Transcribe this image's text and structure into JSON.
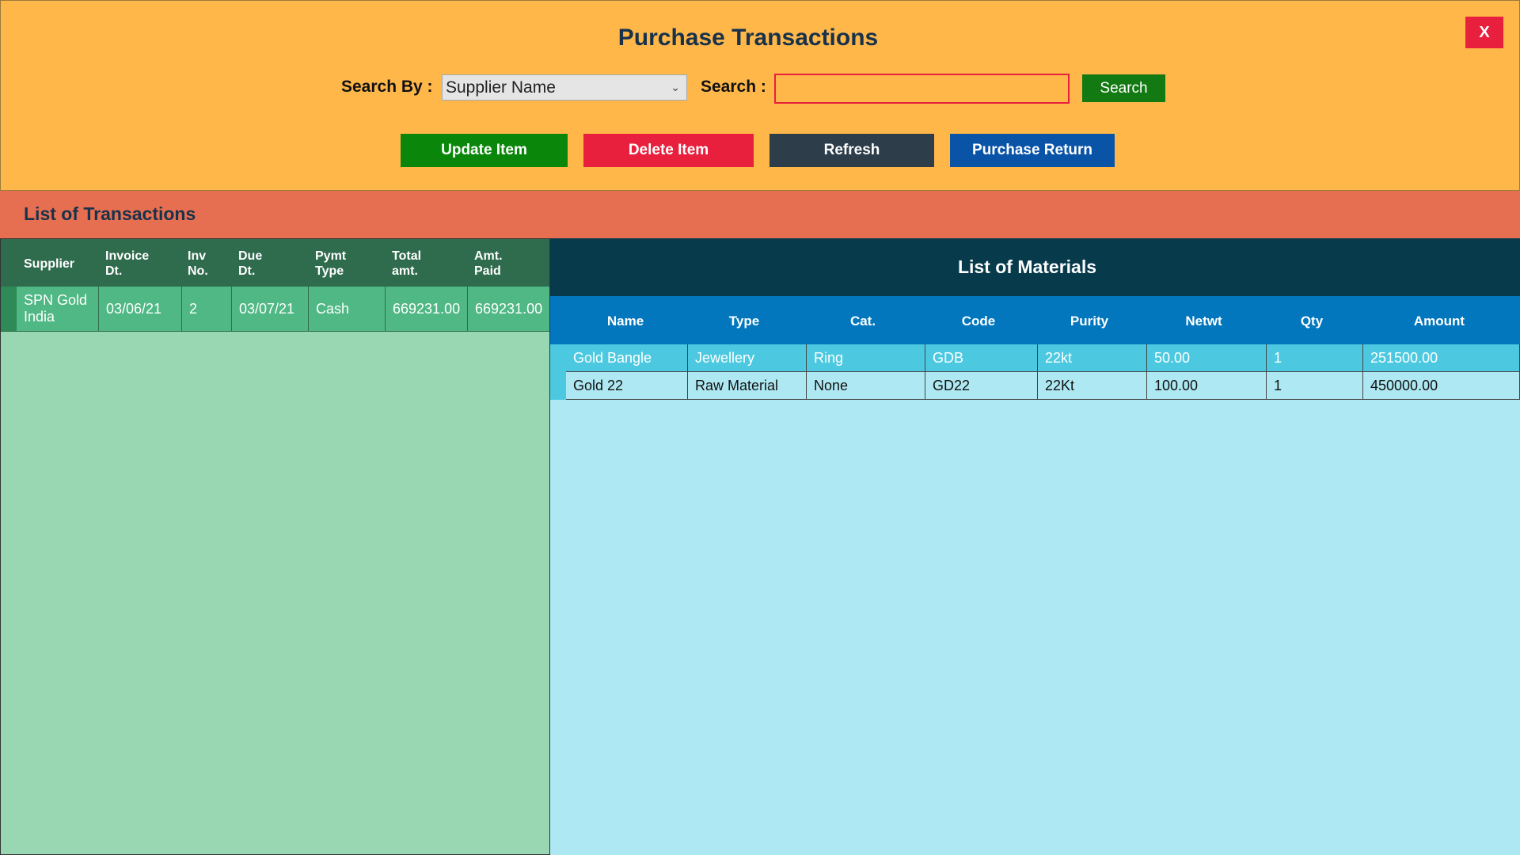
{
  "header": {
    "title": "Purchase Transactions",
    "close_label": "X",
    "search_by_label": "Search By :",
    "search_by_value": "Supplier Name",
    "search_label": "Search :",
    "search_value": "",
    "search_button": "Search",
    "actions": {
      "update": "Update Item",
      "delete": "Delete Item",
      "refresh": "Refresh",
      "purchase_return": "Purchase Return"
    }
  },
  "section_title": "List of Transactions",
  "transactions": {
    "columns": [
      "Supplier",
      "Invoice Dt.",
      "Inv No.",
      "Due Dt.",
      "Pymt Type",
      "Total amt.",
      "Amt. Paid"
    ],
    "rows": [
      {
        "supplier": "SPN Gold India",
        "invoice_dt": "03/06/21",
        "inv_no": "2",
        "due_dt": "03/07/21",
        "pymt_type": "Cash",
        "total_amt": "669231.00",
        "amt_paid": "669231.00"
      }
    ]
  },
  "materials": {
    "title": "List of Materials",
    "columns": [
      "Name",
      "Type",
      "Cat.",
      "Code",
      "Purity",
      "Netwt",
      "Qty",
      "Amount"
    ],
    "rows": [
      {
        "name": "Gold Bangle",
        "type": "Jewellery",
        "cat": "Ring",
        "code": "GDB",
        "purity": "22kt",
        "netwt": "50.00",
        "qty": "1",
        "amount": "251500.00"
      },
      {
        "name": "Gold 22",
        "type": "Raw Material",
        "cat": "None",
        "code": "GD22",
        "purity": "22Kt",
        "netwt": "100.00",
        "qty": "1",
        "amount": "450000.00"
      }
    ]
  },
  "colors": {
    "header_bg": "#ffb74a",
    "section_bar": "#e76f51",
    "transactions_header": "#2f6b4d",
    "transactions_body": "#98d7b1",
    "materials_title": "#073b4c",
    "materials_header": "#0277bd",
    "materials_body": "#aee8f2"
  }
}
